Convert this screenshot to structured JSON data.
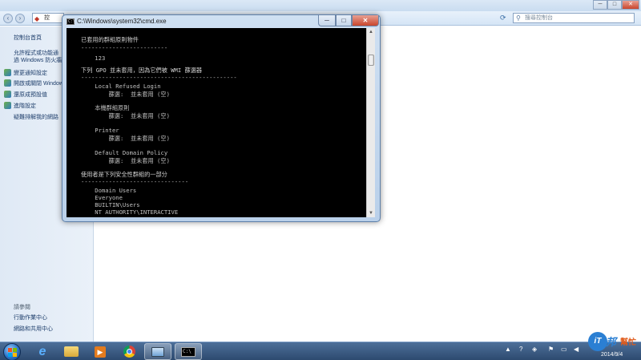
{
  "explorer": {
    "address_text": "控",
    "search_placeholder": "搜尋控制台",
    "sidebar": {
      "home": "控制台首頁",
      "items": [
        "允許程式或功能通過 Windows 防火牆",
        "變更通知設定",
        "開啟或關閉 Windows 防火牆",
        "還原成預設值",
        "進階設定",
        "疑難排解我的網路"
      ],
      "see_also_heading": "請參閱",
      "see_also": [
        "行動作業中心",
        "網路和共用中心"
      ]
    }
  },
  "cmd": {
    "title": "C:\\Windows\\system32\\cmd.exe",
    "lines": [
      "已套用的群組原則物件",
      "-------------------------",
      "    123",
      "下列 GPO 並未套用，因為它們被 WMI 篩選器",
      "---------------------------------------------",
      "    Local Refused Login",
      "        篩選:  並未套用 (空)",
      "    本機群組原則",
      "        篩選:  並未套用 (空)",
      "    Printer",
      "        篩選:  並未套用 (空)",
      "    Default Domain Policy",
      "        篩選:  並未套用 (空)",
      "使用者是下列安全性群組的一部分",
      "-------------------------------",
      "    Domain Users",
      "    Everyone",
      "    BUILTIN\\Users",
      "    NT AUTHORITY\\INTERACTIVE"
    ]
  },
  "taskbar": {
    "date": "2014/9/4"
  },
  "watermark": {
    "badge": "iT",
    "brand": "邦",
    "sub": "幫忙"
  }
}
